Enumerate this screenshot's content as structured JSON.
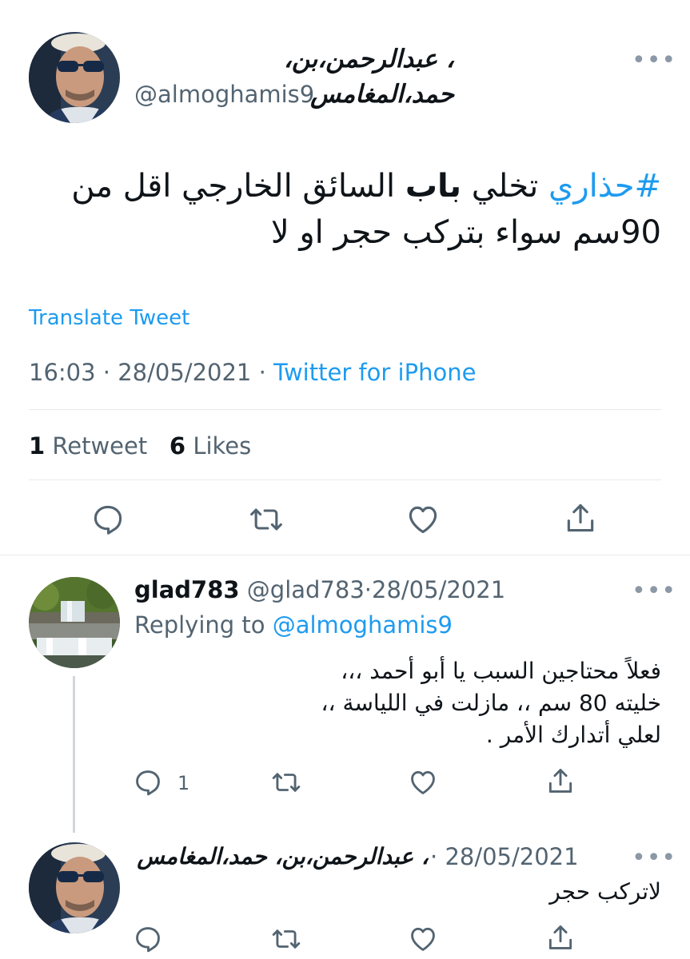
{
  "main_tweet": {
    "display_name": "، عبدالرحمن،بن، حمد،المغامس",
    "handle": "@almoghamis9",
    "hashtag": "#حذاري",
    "text_part1": " تخلي ",
    "text_bold": "باب",
    "text_part2": " السائق الخارجي اقل من",
    "text_line2": "90سم سواء بتركب حجر او لا",
    "translate_label": "Translate Tweet",
    "time": "16:03",
    "date": "28/05/2021",
    "source": "Twitter for iPhone",
    "retweets_count": "1",
    "retweets_label": "Retweet",
    "likes_count": "6",
    "likes_label": "Likes",
    "separator": "·"
  },
  "reply1": {
    "display_name": "glad783",
    "handle": "@glad783",
    "date": "28/05/2021",
    "replying_to_label": "Replying to",
    "replying_to_handle": "@almoghamis9",
    "text_line1": "فعلاً محتاجين السبب يا أبو أحمد ،،،",
    "text_line2": "خليته 80 سم ،، مازلت في اللياسة ،،",
    "text_line3": "لعلي أتدارك الأمر .",
    "reply_count": "1"
  },
  "reply2": {
    "display_name": "، عبدالرحمن،بن، حمد،المغامس",
    "date": "28/05/2021",
    "text": "لاتركب حجر"
  },
  "colors": {
    "accent": "#1d9bf0",
    "muted": "#536471",
    "divider": "#e6e9ec",
    "text": "#0f1419"
  }
}
